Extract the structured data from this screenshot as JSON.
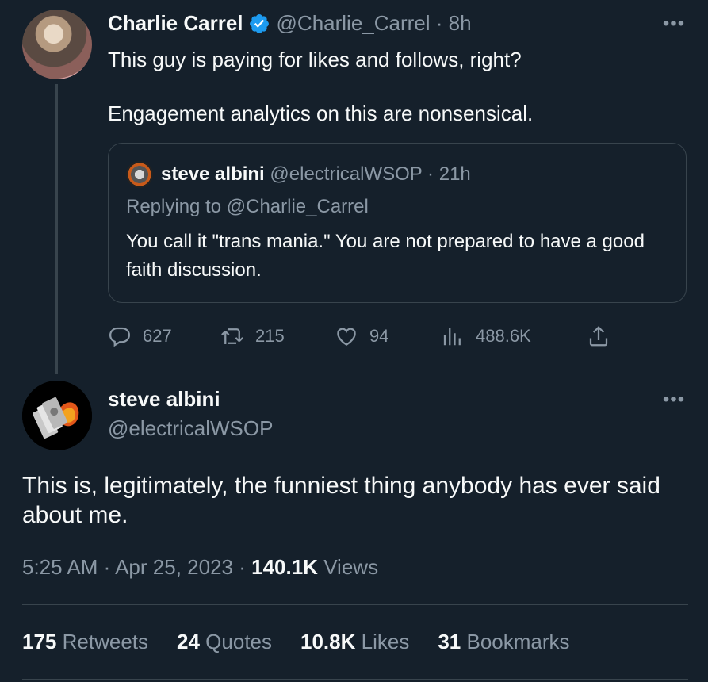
{
  "parent": {
    "name": "Charlie Carrel",
    "handle": "@Charlie_Carrel",
    "time": "8h",
    "lines": [
      "This guy is paying for likes and follows, right?",
      "Engagement analytics on this are nonsensical."
    ],
    "quote": {
      "name": "steve albini",
      "handle": "@electricalWSOP",
      "time": "21h",
      "reply_label": "Replying to",
      "reply_handle": "@Charlie_Carrel",
      "text": "You call it \"trans mania.\" You are not prepared to have a good faith discussion."
    },
    "actions": {
      "replies": "627",
      "retweets": "215",
      "likes": "94",
      "views": "488.6K"
    }
  },
  "main": {
    "name": "steve albini",
    "handle": "@electricalWSOP",
    "text": "This is, legitimately, the funniest thing anybody has ever said about me.",
    "time": "5:25 AM",
    "date": "Apr 25, 2023",
    "views_count": "140.1K",
    "views_label": "Views",
    "stats": [
      {
        "count": "175",
        "label": "Retweets"
      },
      {
        "count": "24",
        "label": "Quotes"
      },
      {
        "count": "10.8K",
        "label": "Likes"
      },
      {
        "count": "31",
        "label": "Bookmarks"
      }
    ]
  },
  "colors": {
    "background": "#15202b",
    "muted": "#8b98a5",
    "verified": "#1d9bf0",
    "border": "#38444d"
  }
}
